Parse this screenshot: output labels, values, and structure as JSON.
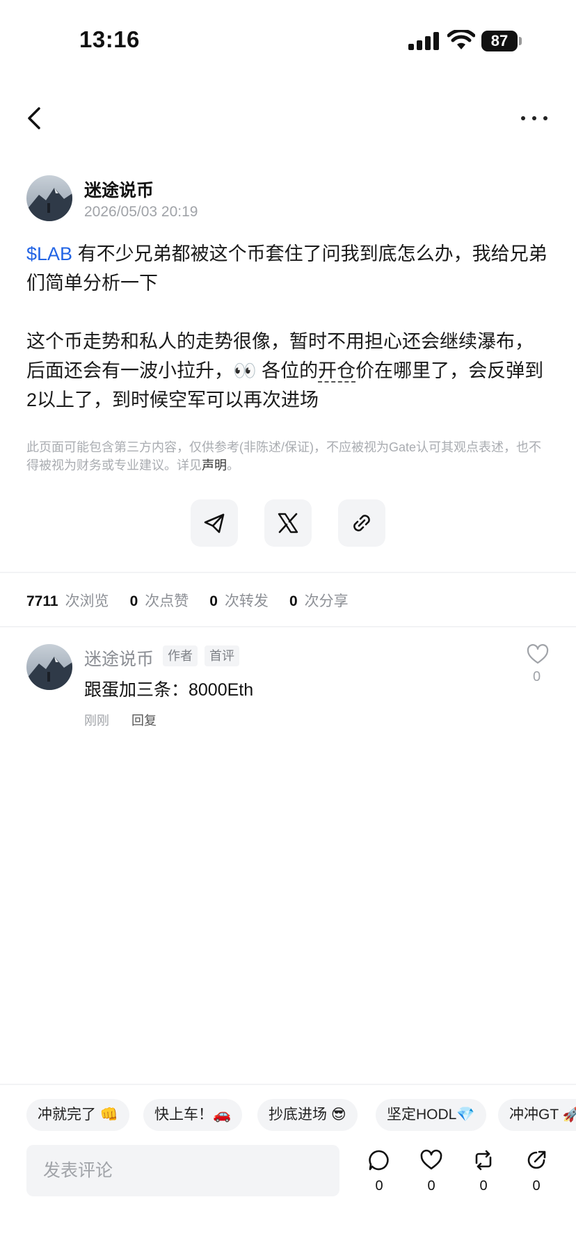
{
  "status_bar": {
    "time": "13:16",
    "battery": "87"
  },
  "post": {
    "author": "迷途说币",
    "time": "2026/05/03 20:19",
    "ticker": "$LAB",
    "para1_rest": " 有不少兄弟都被这个币套住了问我到底怎么办，我给兄弟们简单分析一下",
    "para2_a": "这个币走势和私人的走势很像，暂时不用担心还会继续瀑布，后面还会有一波小拉升，👀 各位的",
    "para2_link": "开仓",
    "para2_b": "价在哪里了，会反弹到2以上了，到时候空军可以再次进场",
    "disclaimer_text": "此页面可能包含第三方内容，仅供参考(非陈述/保证)，不应被视为Gate认可其观点表述，也不得被视为财务或专业建议。详见",
    "disclaimer_link": "声明",
    "disclaimer_end": "。"
  },
  "share": {
    "icons": [
      "telegram-icon",
      "x-icon",
      "link-icon"
    ]
  },
  "stats": {
    "views": "7711",
    "views_label": "次浏览",
    "likes": "0",
    "likes_label": "次点赞",
    "reposts": "0",
    "reposts_label": "次转发",
    "shares": "0",
    "shares_label": "次分享"
  },
  "comment": {
    "author": "迷途说币",
    "tag_author": "作者",
    "tag_first": "首评",
    "text": "跟蛋加三条：8000Eth",
    "time": "刚刚",
    "reply": "回复",
    "likes": "0"
  },
  "quick_reactions": [
    "冲就完了 👊",
    "快上车！🚗",
    "抄底进场 😎",
    "坚定HODL💎",
    "冲冲GT 🚀"
  ],
  "bottom_bar": {
    "placeholder": "发表评论",
    "comment_count": "0",
    "like_count": "0",
    "repost_count": "0",
    "share_count": "0"
  },
  "colors": {
    "accent": "#2264e5",
    "muted": "#a0a3a8",
    "chip_bg": "#f3f4f6"
  }
}
